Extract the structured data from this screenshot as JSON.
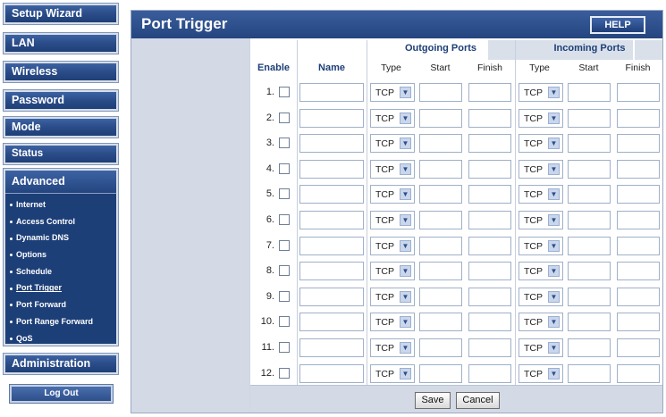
{
  "sidebar": {
    "buttons": {
      "setup_wizard": "Setup Wizard",
      "lan": "LAN",
      "wireless": "Wireless",
      "password": "Password",
      "mode": "Mode",
      "status": "Status",
      "administration": "Administration",
      "logout": "Log Out"
    },
    "advanced": {
      "title": "Advanced",
      "items": [
        {
          "label": "Internet"
        },
        {
          "label": "Access Control"
        },
        {
          "label": "Dynamic DNS"
        },
        {
          "label": "Options"
        },
        {
          "label": "Schedule"
        },
        {
          "label": "Port Trigger",
          "current": true
        },
        {
          "label": "Port Forward"
        },
        {
          "label": "Port Range Forward"
        },
        {
          "label": "QoS"
        }
      ]
    }
  },
  "page": {
    "title": "Port Trigger",
    "help_label": "HELP"
  },
  "table": {
    "headers": {
      "enable": "Enable",
      "name": "Name",
      "outgoing": "Outgoing Ports",
      "incoming": "Incoming Ports",
      "type": "Type",
      "start": "Start",
      "finish": "Finish"
    },
    "rows": [
      {
        "num": "1.",
        "out_type": "TCP",
        "in_type": "TCP"
      },
      {
        "num": "2.",
        "out_type": "TCP",
        "in_type": "TCP"
      },
      {
        "num": "3.",
        "out_type": "TCP",
        "in_type": "TCP"
      },
      {
        "num": "4.",
        "out_type": "TCP",
        "in_type": "TCP"
      },
      {
        "num": "5.",
        "out_type": "TCP",
        "in_type": "TCP"
      },
      {
        "num": "6.",
        "out_type": "TCP",
        "in_type": "TCP"
      },
      {
        "num": "7.",
        "out_type": "TCP",
        "in_type": "TCP"
      },
      {
        "num": "8.",
        "out_type": "TCP",
        "in_type": "TCP"
      },
      {
        "num": "9.",
        "out_type": "TCP",
        "in_type": "TCP"
      },
      {
        "num": "10.",
        "out_type": "TCP",
        "in_type": "TCP"
      },
      {
        "num": "11.",
        "out_type": "TCP",
        "in_type": "TCP"
      },
      {
        "num": "12.",
        "out_type": "TCP",
        "in_type": "TCP"
      }
    ]
  },
  "actions": {
    "save": "Save",
    "cancel": "Cancel"
  },
  "colors": {
    "nav_blue": "#2a4c88",
    "header_text": "#1d3f78",
    "frame_gray": "#cfd7e4"
  }
}
